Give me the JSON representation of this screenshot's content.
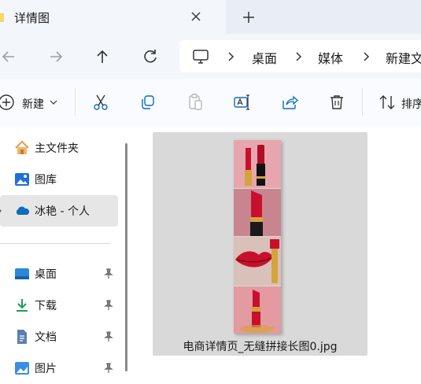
{
  "tab": {
    "title": "详情图"
  },
  "breadcrumb": {
    "items": [
      "桌面",
      "媒体",
      "新建文"
    ]
  },
  "toolbar": {
    "new_label": "新建",
    "sort_label": "排序"
  },
  "sidebar": {
    "items": [
      {
        "label": "主文件夹",
        "icon": "home-icon"
      },
      {
        "label": "图库",
        "icon": "gallery-icon"
      },
      {
        "label": "冰艳 - 个人",
        "icon": "onedrive-cloud-icon",
        "selected": true
      },
      {
        "label": "桌面",
        "icon": "desktop-icon",
        "pinned": true
      },
      {
        "label": "下载",
        "icon": "download-icon",
        "pinned": true
      },
      {
        "label": "文档",
        "icon": "document-icon",
        "pinned": true
      },
      {
        "label": "图片",
        "icon": "pictures-icon",
        "pinned": true
      }
    ]
  },
  "files": [
    {
      "name": "电商详情页_无缝拼接长图0.jpg",
      "selected": true
    }
  ],
  "colors": {
    "accent": "#0f6cbd",
    "folder": "#f2c94c",
    "lipstick": "#c8102e"
  }
}
